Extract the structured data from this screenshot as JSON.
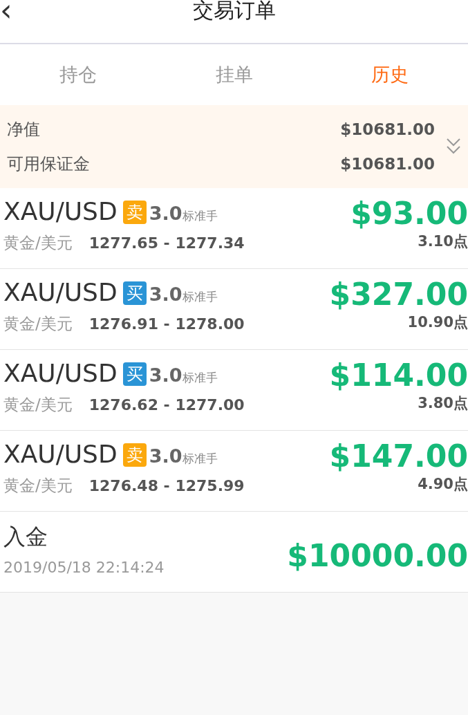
{
  "header": {
    "title": "交易订单",
    "back": "‹"
  },
  "tabs": [
    {
      "label": "持仓",
      "selected": false
    },
    {
      "label": "挂单",
      "selected": false
    },
    {
      "label": "历史",
      "selected": true
    }
  ],
  "summary": {
    "expanded": false,
    "rows": [
      {
        "label": "净值",
        "value": "$10681.00"
      },
      {
        "label": "可用保证金",
        "value": "$10681.00"
      }
    ]
  },
  "orders": [
    {
      "kind": "trade",
      "symbol": "XAU/USD",
      "side": "卖",
      "color": "#fba80d",
      "lots": "3.0",
      "unit": "标准手",
      "name": "黄金/美元",
      "prices": "1277.65 - 1277.34",
      "profit": "$93.00",
      "points": "3.10点"
    },
    {
      "kind": "trade",
      "symbol": "XAU/USD",
      "side": "买",
      "color": "#2a94d6",
      "lots": "3.0",
      "unit": "标准手",
      "name": "黄金/美元",
      "prices": "1276.91 - 1278.00",
      "profit": "$327.00",
      "points": "10.90点"
    },
    {
      "kind": "trade",
      "symbol": "XAU/USD",
      "side": "买",
      "color": "#2a94d6",
      "lots": "3.0",
      "unit": "标准手",
      "name": "黄金/美元",
      "prices": "1276.62 - 1277.00",
      "profit": "$114.00",
      "points": "3.80点"
    },
    {
      "kind": "trade",
      "symbol": "XAU/USD",
      "side": "卖",
      "color": "#fba80d",
      "lots": "3.0",
      "unit": "标准手",
      "name": "黄金/美元",
      "prices": "1276.48 - 1275.99",
      "profit": "$147.00",
      "points": "4.90点"
    },
    {
      "kind": "deposit",
      "title": "入金",
      "time": "2019/05/18 22:14:24",
      "amount": "$10000.00"
    }
  ]
}
